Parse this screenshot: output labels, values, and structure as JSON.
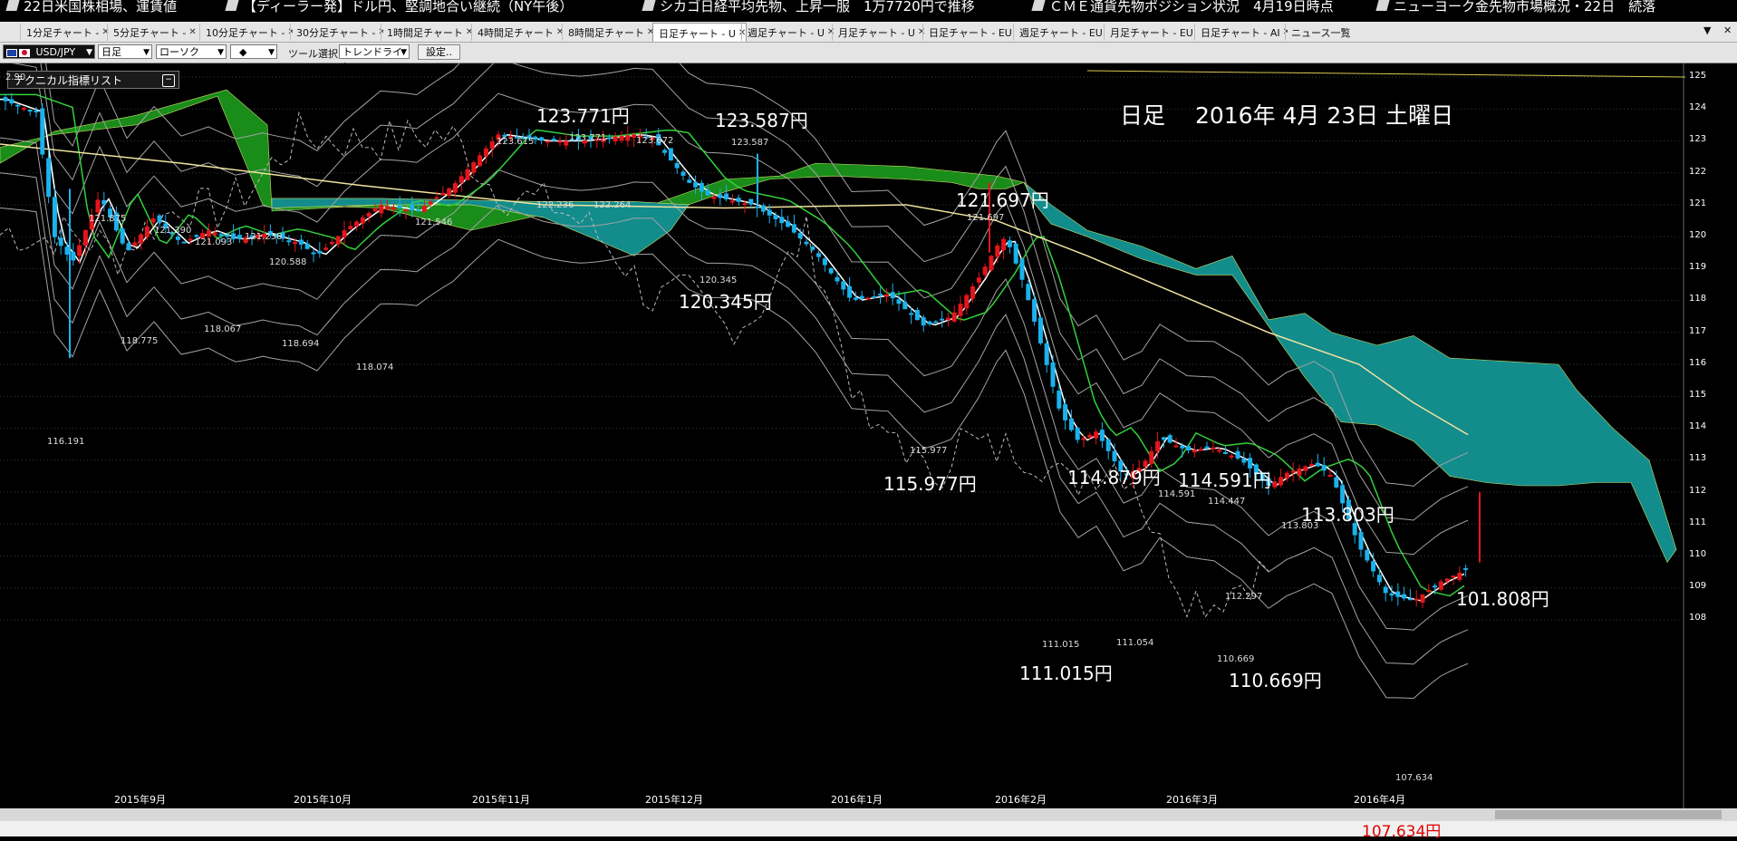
{
  "ticker": [
    "22日米国株相場、運賃値",
    "【ディーラー発】ドル円、堅調地合い継続（NY午後）",
    "シカゴ日経平均先物、上昇一服　1万7720円で推移",
    "ＣＭＥ通貨先物ポジション状況　4月19日時点",
    "ニューヨーク金先物市場概況・22日　続落"
  ],
  "tabs": [
    {
      "label": "1分足チャート - ",
      "active": false
    },
    {
      "label": "5分足チャート - ",
      "active": false
    },
    {
      "label": "10分足チャート - ",
      "active": false
    },
    {
      "label": "30分足チャート - ",
      "active": false
    },
    {
      "label": "1時間足チャート",
      "active": false
    },
    {
      "label": "4時間足チャート",
      "active": false
    },
    {
      "label": "8時間足チャート",
      "active": false
    },
    {
      "label": "日足チャート - U",
      "active": true
    },
    {
      "label": "週足チャート - U",
      "active": false
    },
    {
      "label": "月足チャート - U",
      "active": false
    },
    {
      "label": "日足チャート - EU",
      "active": false
    },
    {
      "label": "週足チャート - EU",
      "active": false
    },
    {
      "label": "月足チャート - EU",
      "active": false
    },
    {
      "label": "日足チャート - AI",
      "active": false
    },
    {
      "label": "ニュース一覧",
      "active": false
    }
  ],
  "toolbar": {
    "pair": "USD/JPY",
    "timeframe": "日足",
    "chart_type": "ローソク",
    "marker": "◆",
    "tool_label": "ツール選択",
    "tool": "トレンドライン",
    "settings": "設定..",
    "pair_flag_colors": [
      "#1d3fa8",
      "#c8102e"
    ]
  },
  "indicator_panel": {
    "title": "テクニカル指標リスト"
  },
  "chart_title": "日足　 2016年 4月 23日 土曜日",
  "chart_data": {
    "type": "candlestick",
    "y_ticks": [
      125,
      124,
      123,
      122,
      121,
      120,
      119,
      118,
      117,
      116,
      115,
      114,
      113,
      112,
      111,
      110,
      109,
      108
    ],
    "ylim": [
      107.5,
      125.5
    ],
    "x_ticks": [
      "2015年9月",
      "2015年10月",
      "2015年11月",
      "2015年12月",
      "2016年1月",
      "2016年2月",
      "2016年3月",
      "2016年4月"
    ],
    "big_labels": [
      "123.771円",
      "123.587円",
      "120.345円",
      "121.697円",
      "115.977円",
      "114.879円",
      "114.591円",
      "113.803円",
      "111.015円",
      "110.669円",
      "101.808円",
      "107.634円"
    ],
    "small_labels": [
      "121.875",
      "121.390",
      "121.093",
      "121.230",
      "120.588",
      "121.546",
      "123.615",
      "123.771",
      "123.672",
      "123.587",
      "122.236",
      "122.264",
      "120.345",
      "121.697",
      "118.775",
      "118.067",
      "118.694",
      "118.074",
      "116.191",
      "115.977",
      "114.591",
      "114.447",
      "113.803",
      "112.297",
      "111.015",
      "111.054",
      "110.669",
      "107.634",
      "2.90"
    ],
    "colors": {
      "up": "#e4151b",
      "down": "#1bb2ec",
      "ma_fast": "#ffffff",
      "ma_mid": "#33d13a",
      "ma_slow": "#f0e3a0",
      "cloud_bull": "#1a8c1a",
      "cloud_bear": "#138c8c",
      "band": "#a3a3a3"
    }
  },
  "bottom_price": "107.634円"
}
